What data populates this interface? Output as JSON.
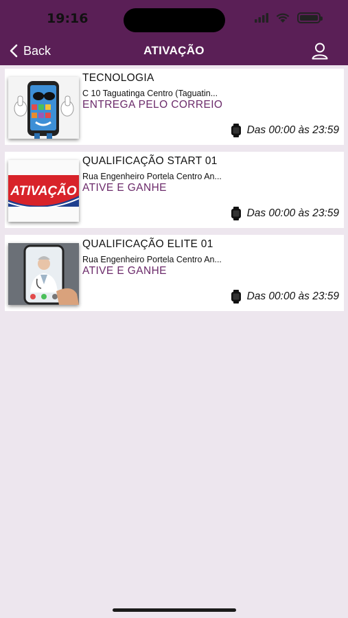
{
  "status_bar": {
    "time": "19:16"
  },
  "nav": {
    "back_label": "Back",
    "title": "ATIVAÇÃO"
  },
  "items": [
    {
      "title": "TECNOLOGIA",
      "address": "C 10 Taguatinga Centro (Taguatin...",
      "tag": "ENTREGA PELO CORREIO",
      "hours": "Das 00:00 às 23:59",
      "image": "phone-mascot-thumbs-up"
    },
    {
      "title": "QUALIFICAÇÃO START 01",
      "address": "Rua Engenheiro Portela Centro An...",
      "tag": "ATIVE E GANHE",
      "hours": "Das 00:00 às 23:59",
      "image": "ativacao-logo",
      "image_text": "ATIVAÇÃO"
    },
    {
      "title": "QUALIFICAÇÃO ELITE 01",
      "address": "Rua Engenheiro Portela Centro An...",
      "tag": "ATIVE E GANHE",
      "hours": "Das 00:00 às 23:59",
      "image": "doctor-video-call-phone"
    }
  ],
  "colors": {
    "header": "#5a1f56",
    "tag": "#6b2a6a",
    "background": "#ede6ee"
  }
}
